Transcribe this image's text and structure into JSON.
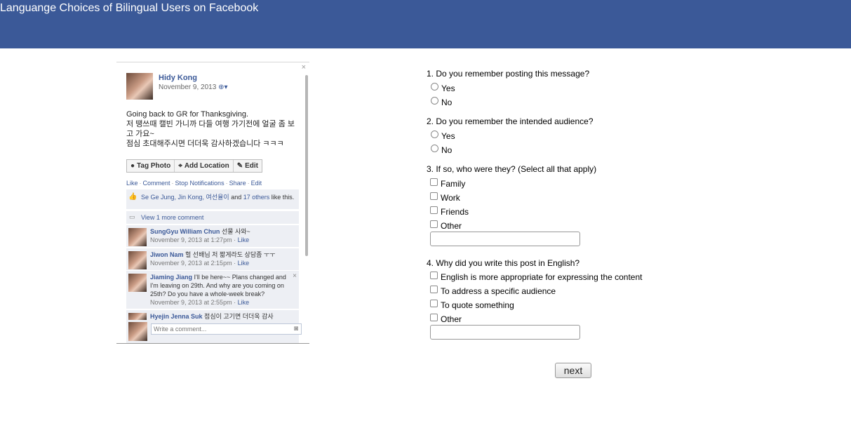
{
  "header": {
    "title": "Languange Choices of Bilingual Users on Facebook",
    "bg_color": "#3b5998"
  },
  "post": {
    "close_icon": "×",
    "author": "Hidy Kong",
    "date": "November 9, 2013",
    "audience_icon": "globe-dropdown",
    "message": [
      "Going back to GR for Thanksgiving.",
      "저 땡쓰때 캘빈 가니까 다들 여행 가기전에 얼굴 좀 보고 가요~",
      "점심 초대해주시면 더더욱 감사하겠습니다 ㅋㅋㅋ"
    ],
    "actions": [
      "Tag Photo",
      "Add Location",
      "Edit"
    ],
    "links": [
      "Like",
      "Comment",
      "Stop Notifications",
      "Share",
      "Edit"
    ],
    "likes": {
      "names": "Se Ge Jung, Jin Kong, 여선율이",
      "and": "and",
      "others": "17 others",
      "suffix": "like this."
    },
    "view_more": "View 1 more comment",
    "comments": [
      {
        "name": "SungGyu William Chun",
        "text": "선물 사와~",
        "time": "November 9, 2013 at 1:27pm",
        "like": "Like"
      },
      {
        "name": "Jiwon Nam",
        "text": "헐 선배님 저 짧게라도 상담좀 ㅜㅜ",
        "time": "November 9, 2013 at 2:15pm",
        "like": "Like"
      },
      {
        "name": "Jiaming Jiang",
        "text": "I'll be here~~ Plans changed and I'm leaving on 29th. And why are you coming on 25th? Do you have a whole-week break?",
        "time": "November 9, 2013 at 2:55pm",
        "like": "Like"
      },
      {
        "name": "Hyejin Jenna Suk",
        "text": "점심이 고기면 더더욱 감사",
        "time": "",
        "like": ""
      }
    ],
    "write_placeholder": "Write a comment..."
  },
  "questions": {
    "q1": {
      "label": "1. Do you remember posting this message?",
      "options": [
        "Yes",
        "No"
      ]
    },
    "q2": {
      "label": "2. Do you remember the intended audience?",
      "options": [
        "Yes",
        "No"
      ]
    },
    "q3": {
      "label": "3. If so, who were they? (Select all that apply)",
      "options": [
        "Family",
        "Work",
        "Friends",
        "Other"
      ]
    },
    "q4": {
      "label": "4. Why did you write this post in English?",
      "options": [
        "English is more appropriate for expressing the content",
        "To address a specific audience",
        "To quote something",
        "Other"
      ]
    }
  },
  "next_label": "next"
}
